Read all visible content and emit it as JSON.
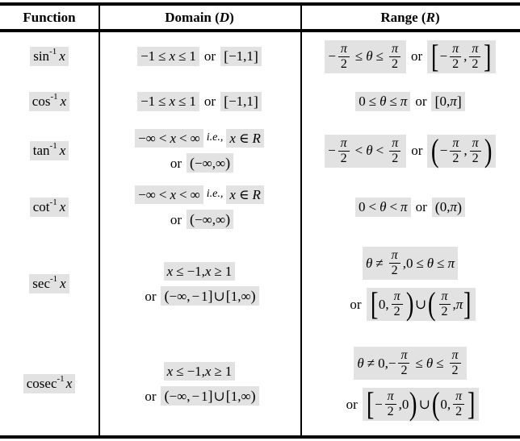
{
  "table": {
    "headers": {
      "function": "Function",
      "domain_label": "Domain",
      "domain_symbol": "D",
      "range_label": "Range",
      "range_symbol": "R"
    },
    "conjunction": "or",
    "ie": "i.e.,",
    "rows": [
      {
        "function": "sin",
        "function_exponent": "-1",
        "function_arg": "x",
        "function_display": "sin⁻¹ x",
        "domain_inequality": "−1 ≤ x ≤ 1",
        "domain_interval": "[−1,1]",
        "range_inequality": "−π/2 ≤ θ ≤ π/2",
        "range_interval": "[−π/2, π/2]"
      },
      {
        "function": "cos",
        "function_exponent": "-1",
        "function_arg": "x",
        "function_display": "cos⁻¹ x",
        "domain_inequality": "−1 ≤ x ≤ 1",
        "domain_interval": "[−1,1]",
        "range_inequality": "0 ≤ θ ≤ π",
        "range_interval": "[0,π]"
      },
      {
        "function": "tan",
        "function_exponent": "-1",
        "function_arg": "x",
        "function_display": "tan⁻¹ x",
        "domain_inequality": "−∞ < x < ∞",
        "domain_set": "x ∈ R",
        "domain_interval": "(−∞,∞)",
        "range_inequality": "−π/2 < θ < π/2",
        "range_interval": "(−π/2, π/2)"
      },
      {
        "function": "cot",
        "function_exponent": "-1",
        "function_arg": "x",
        "function_display": "cot⁻¹ x",
        "domain_inequality": "−∞ < x < ∞",
        "domain_set": "x ∈ R",
        "domain_interval": "(−∞,∞)",
        "range_inequality": "0 < θ < π",
        "range_interval": "(0,π)"
      },
      {
        "function": "sec",
        "function_exponent": "-1",
        "function_arg": "x",
        "function_display": "sec⁻¹ x",
        "domain_inequality": "x ≤ −1, x ≥ 1",
        "domain_interval": "(−∞,−1] ∪ [1,∞)",
        "range_inequality": "θ ≠ π/2, 0 ≤ θ ≤ π",
        "range_interval": "[0,π/2) ∪ (π/2,π]"
      },
      {
        "function": "cosec",
        "function_exponent": "-1",
        "function_arg": "x",
        "function_display": "cosec⁻¹ x",
        "domain_inequality": "x ≤ −1, x ≥ 1",
        "domain_interval": "(−∞,−1] ∪ [1,∞)",
        "range_inequality": "θ ≠ 0, −π/2 ≤ θ ≤ π/2",
        "range_interval": "[−π/2,0) ∪ (0,π/2]"
      }
    ]
  },
  "symbols": {
    "pi": "π",
    "theta": "θ",
    "infinity": "∞",
    "leq": "≤",
    "lt": "<",
    "geq": "≥",
    "gt": ">",
    "neq": "≠",
    "in": "∈",
    "cup": "∪",
    "minus": "−",
    "two": "2",
    "zero": "0",
    "one": "1",
    "R": "R",
    "x": "x",
    "comma": ","
  },
  "colors": {
    "highlight": "#e2e2e2",
    "rule": "#000000",
    "background": "#ffffff",
    "text": "#000000"
  }
}
